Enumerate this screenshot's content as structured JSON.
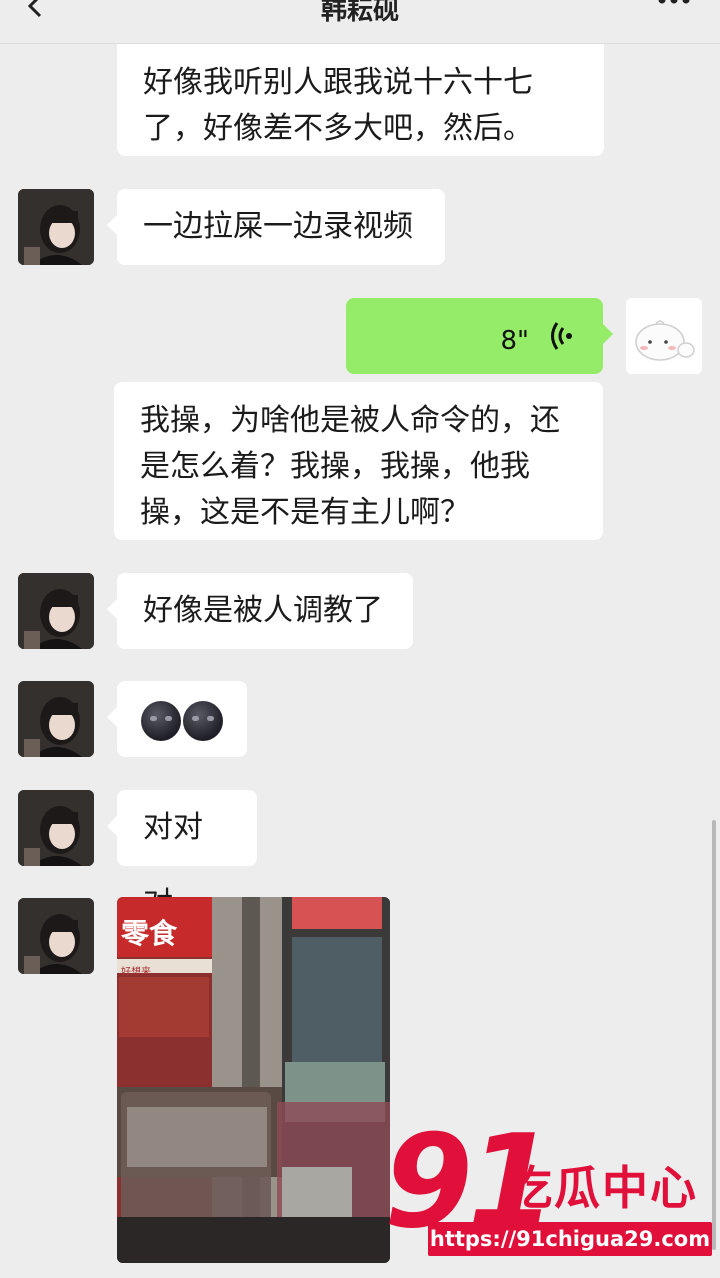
{
  "header": {
    "title": "韩耘砚",
    "back_icon": "chevron-left-icon",
    "more_icon": "more-dots-icon"
  },
  "messages": [
    {
      "lines": [
        "好像我听别人跟我说十六十七",
        "了，好像差不多大吧，然后。"
      ]
    },
    {
      "text": "一边拉屎一边录视频"
    },
    {
      "voice_duration": "8\"",
      "voice_icon": "voice-wave-icon"
    },
    {
      "lines": [
        "我操，为啥他是被人命令的，还",
        "是怎么着？我操，我操，他我",
        "操，这是不是有主儿啊？"
      ]
    },
    {
      "text": "好像是被人调教了"
    },
    {
      "emoji": "new-moon-face-emoji x2"
    },
    {
      "text": "对对对"
    },
    {
      "photo_sign": "零食",
      "photo_sign2": "好想来"
    }
  ],
  "watermark": {
    "number": "91",
    "text": "吃瓜中心",
    "url": "https://91chigua29.com"
  },
  "colors": {
    "background": "#ededed",
    "bubble_white": "#ffffff",
    "bubble_green": "#95ec69",
    "watermark_red": "#e0103a"
  }
}
